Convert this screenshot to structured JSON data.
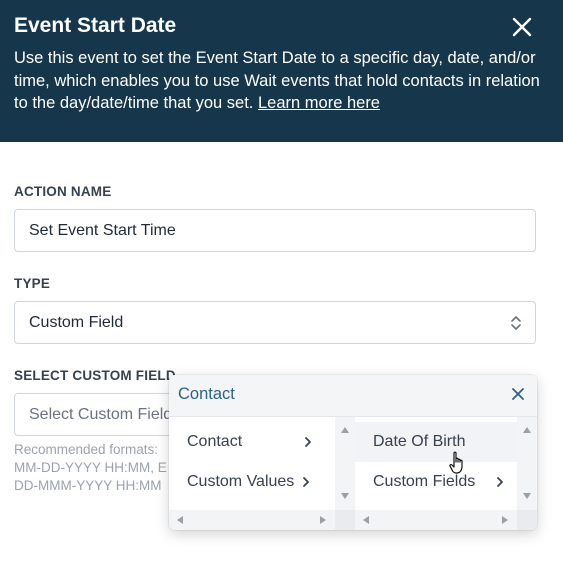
{
  "header": {
    "title": "Event Start Date",
    "description": "Use this event to set the Event Start Date to a specific day, date, and/or time, which enables you to use Wait events that hold contacts in relation to the day/date/time that you set.",
    "learn_more": "Learn more here",
    "close_icon": "close-icon"
  },
  "action_name": {
    "label": "ACTION NAME",
    "value": "Set Event Start Time"
  },
  "type": {
    "label": "TYPE",
    "value": "Custom Field",
    "icon": "sort-arrows-icon"
  },
  "custom_field": {
    "label": "SELECT CUSTOM FIELD",
    "placeholder": "Select Custom Field",
    "help_line1": "Recommended formats:",
    "help_line2": "MM-DD-YYYY HH:MM, E",
    "help_line3": "DD-MMM-YYYY HH:MM"
  },
  "cascader": {
    "title": "Contact",
    "column1": [
      {
        "label": "Contact"
      },
      {
        "label": "Custom Values"
      }
    ],
    "column2": [
      {
        "label": "Date Of Birth"
      },
      {
        "label": "Custom Fields"
      }
    ]
  },
  "colors": {
    "header_bg": "#16374b",
    "cascader_title": "#2e6287",
    "help_text": "#9aa3ad"
  }
}
